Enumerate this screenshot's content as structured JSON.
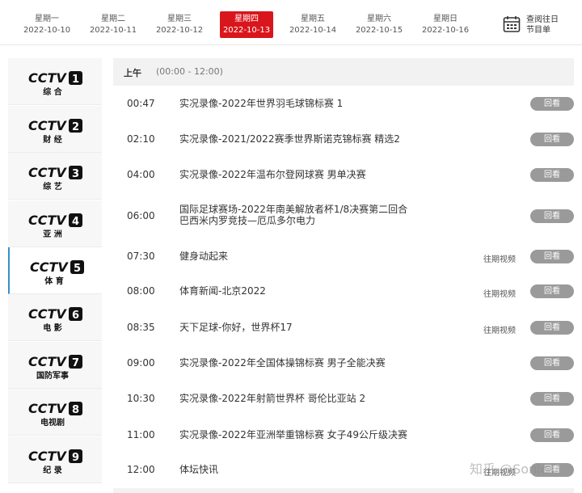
{
  "datebar": {
    "days": [
      {
        "name": "星期一",
        "date": "2022-10-10"
      },
      {
        "name": "星期二",
        "date": "2022-10-11"
      },
      {
        "name": "星期三",
        "date": "2022-10-12"
      },
      {
        "name": "星期四",
        "date": "2022-10-13"
      },
      {
        "name": "星期五",
        "date": "2022-10-14"
      },
      {
        "name": "星期六",
        "date": "2022-10-15"
      },
      {
        "name": "星期日",
        "date": "2022-10-16"
      }
    ],
    "history_line1": "查阅往日",
    "history_line2": "节目单"
  },
  "colors": {
    "accent_red": "#d9161c",
    "active_channel_border": "#3a8ec9",
    "replay_gray": "#9a9a9a"
  },
  "channels": [
    {
      "num": "1",
      "sub": "综 合"
    },
    {
      "num": "2",
      "sub": "财 经"
    },
    {
      "num": "3",
      "sub": "综 艺"
    },
    {
      "num": "4",
      "sub": "亚 洲"
    },
    {
      "num": "5",
      "sub": "体 育"
    },
    {
      "num": "6",
      "sub": "电 影"
    },
    {
      "num": "7",
      "sub": "国防军事"
    },
    {
      "num": "8",
      "sub": "电视剧"
    },
    {
      "num": "9",
      "sub": "纪 录"
    }
  ],
  "logo_text": "CCTV",
  "section": {
    "title": "上午",
    "range": "(00:00 - 12:00)"
  },
  "programs": [
    {
      "time": "00:47",
      "title1": "实况录像-2022年世界羽毛球锦标赛 1",
      "title2": "",
      "past": "",
      "replay": "回看"
    },
    {
      "time": "02:10",
      "title1": "实况录像-2021/2022赛季世界斯诺克锦标赛 精选2",
      "title2": "",
      "past": "",
      "replay": "回看"
    },
    {
      "time": "04:00",
      "title1": "实况录像-2022年温布尔登网球赛 男单决赛",
      "title2": "",
      "past": "",
      "replay": "回看"
    },
    {
      "time": "06:00",
      "title1": "国际足球赛场-2022年南美解放者杯1/8决赛第二回合",
      "title2": "巴西米内罗竞技—厄瓜多尔电力",
      "past": "",
      "replay": "回看"
    },
    {
      "time": "07:30",
      "title1": "健身动起来",
      "title2": "",
      "past": "往期视频",
      "replay": "回看"
    },
    {
      "time": "08:00",
      "title1": "体育新闻-北京2022",
      "title2": "",
      "past": "往期视频",
      "replay": "回看"
    },
    {
      "time": "08:35",
      "title1": "天下足球-你好，世界杯17",
      "title2": "",
      "past": "往期视频",
      "replay": "回看"
    },
    {
      "time": "09:00",
      "title1": "实况录像-2022年全国体操锦标赛 男子全能决赛",
      "title2": "",
      "past": "",
      "replay": "回看"
    },
    {
      "time": "10:30",
      "title1": "实况录像-2022年射箭世界杯 哥伦比亚站 2",
      "title2": "",
      "past": "",
      "replay": "回看"
    },
    {
      "time": "11:00",
      "title1": "实况录像-2022年亚洲举重锦标赛 女子49公斤级决赛",
      "title2": "",
      "past": "",
      "replay": "回看"
    },
    {
      "time": "12:00",
      "title1": "体坛快讯",
      "title2": "",
      "past": "往期视频",
      "replay": "回看"
    }
  ],
  "watermark": "知乎 @Sonic"
}
